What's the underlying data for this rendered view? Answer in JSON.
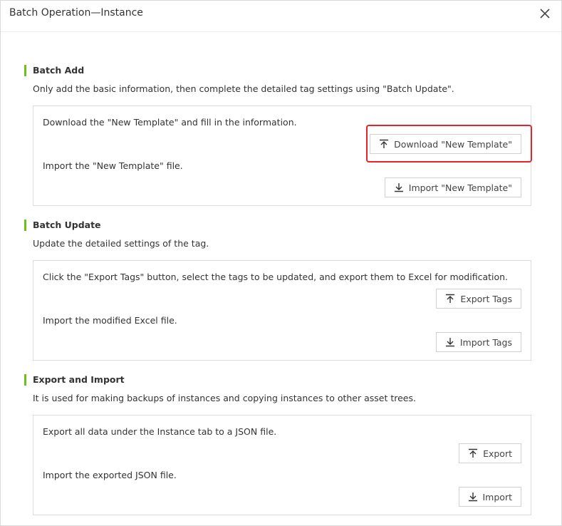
{
  "dialog": {
    "title": "Batch Operation—Instance",
    "close_icon": "close-icon"
  },
  "sections": {
    "batch_add": {
      "title": "Batch Add",
      "description": "Only add the basic information, then complete the detailed tag settings using \"Batch Update\".",
      "step1_text": "Download the \"New Template\" and fill in the information.",
      "step1_button": "Download \"New Template\"",
      "step2_text": "Import the \"New Template\" file.",
      "step2_button": "Import \"New Template\""
    },
    "batch_update": {
      "title": "Batch Update",
      "description": "Update the detailed settings of the tag.",
      "step1_text": "Click the \"Export Tags\" button, select the tags to be updated, and export them to Excel for modification.",
      "step1_button": "Export Tags",
      "step2_text": "Import the modified Excel file.",
      "step2_button": "Import Tags"
    },
    "export_import": {
      "title": "Export and Import",
      "description": "It is used for making backups of instances and copying instances to other asset trees.",
      "step1_text": "Export all data under the Instance tab to a JSON file.",
      "step1_button": "Export",
      "step2_text": "Import the exported JSON file.",
      "step2_button": "Import"
    }
  },
  "icons": {
    "upload": "upload-icon",
    "download": "download-icon"
  },
  "colors": {
    "accent_green": "#6bc21a",
    "highlight_red": "#e8232a",
    "border": "#dcdcdc"
  }
}
